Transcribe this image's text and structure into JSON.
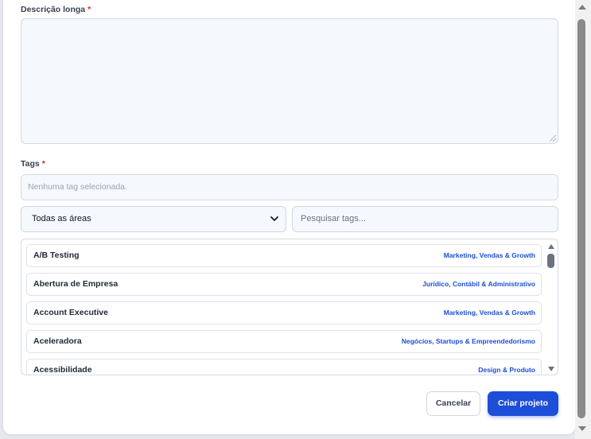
{
  "form": {
    "description": {
      "label": "Descrição longa",
      "required_mark": "*",
      "value": ""
    },
    "tags": {
      "label": "Tags",
      "required_mark": "*",
      "placeholder": "Nenhuma tag selecionada."
    },
    "area_filter": {
      "selected": "Todas as áreas"
    },
    "tag_search": {
      "placeholder": "Pesquisar tags..."
    },
    "tag_list": [
      {
        "name": "A/B Testing",
        "category": "Marketing, Vendas & Growth"
      },
      {
        "name": "Abertura de Empresa",
        "category": "Jurídico, Contábil & Administrativo"
      },
      {
        "name": "Account Executive",
        "category": "Marketing, Vendas & Growth"
      },
      {
        "name": "Aceleradora",
        "category": "Negócios, Startups & Empreendedorismo"
      },
      {
        "name": "Acessibilidade",
        "category": "Design & Produto"
      }
    ]
  },
  "actions": {
    "cancel": "Cancelar",
    "create": "Criar projeto"
  },
  "colors": {
    "primary": "#1d4ed8",
    "required": "#dc2626",
    "input_bg": "#f5f8fc"
  }
}
